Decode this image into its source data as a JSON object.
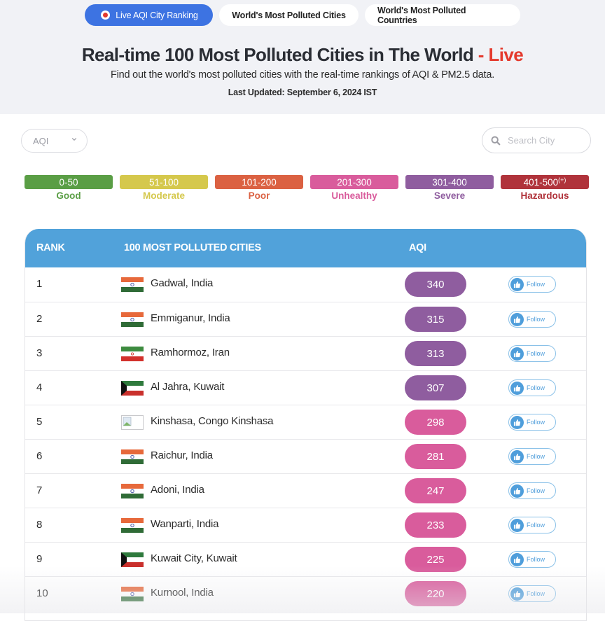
{
  "tabs": [
    {
      "label": "Live AQI City Ranking",
      "active": true,
      "icon": "live-dot-icon"
    },
    {
      "label": "World's Most Polluted Cities",
      "active": false
    },
    {
      "label": "World's Most Polluted Countries",
      "active": false
    }
  ],
  "header": {
    "title": "Real-time 100 Most Polluted Cities in The World",
    "title_live": " - Live",
    "subtitle": "Find out the world's most polluted cities with the real-time rankings of AQI & PM2.5 data.",
    "last_updated": "Last Updated: September 6, 2024 IST"
  },
  "filters": {
    "metric_selected": "AQI",
    "search_placeholder": "Search City"
  },
  "legend": [
    {
      "range": "0-50",
      "sup": "",
      "label": "Good",
      "color": "#5a9e45"
    },
    {
      "range": "51-100",
      "sup": "",
      "label": "Moderate",
      "color": "#d5c84c"
    },
    {
      "range": "101-200",
      "sup": "",
      "label": "Poor",
      "color": "#db6142"
    },
    {
      "range": "201-300",
      "sup": "",
      "label": "Unhealthy",
      "color": "#d95c9c"
    },
    {
      "range": "301-400",
      "sup": "",
      "label": "Severe",
      "color": "#8f5d9f"
    },
    {
      "range": "401-500",
      "sup": "(+)",
      "label": "Hazardous",
      "color": "#b0333b"
    }
  ],
  "table": {
    "headers": {
      "rank": "RANK",
      "city": "100 MOST POLLUTED CITIES",
      "aqi": "AQI"
    },
    "follow_label": "Follow",
    "rows": [
      {
        "rank": "1",
        "city": "Gadwal, India",
        "flag": "india",
        "aqi": "340",
        "color": "#8f5d9f"
      },
      {
        "rank": "2",
        "city": "Emmiganur, India",
        "flag": "india",
        "aqi": "315",
        "color": "#8f5d9f"
      },
      {
        "rank": "3",
        "city": "Ramhormoz, Iran",
        "flag": "iran",
        "aqi": "313",
        "color": "#8f5d9f"
      },
      {
        "rank": "4",
        "city": "Al Jahra, Kuwait",
        "flag": "kuwait",
        "aqi": "307",
        "color": "#8f5d9f"
      },
      {
        "rank": "5",
        "city": "Kinshasa, Congo Kinshasa",
        "flag": "broken",
        "aqi": "298",
        "color": "#d95c9c"
      },
      {
        "rank": "6",
        "city": "Raichur, India",
        "flag": "india",
        "aqi": "281",
        "color": "#d95c9c"
      },
      {
        "rank": "7",
        "city": "Adoni, India",
        "flag": "india",
        "aqi": "247",
        "color": "#d95c9c"
      },
      {
        "rank": "8",
        "city": "Wanparti, India",
        "flag": "india",
        "aqi": "233",
        "color": "#d95c9c"
      },
      {
        "rank": "9",
        "city": "Kuwait City, Kuwait",
        "flag": "kuwait",
        "aqi": "225",
        "color": "#d95c9c"
      },
      {
        "rank": "10",
        "city": "Kurnool, India",
        "flag": "india",
        "aqi": "220",
        "color": "#d95c9c"
      }
    ]
  }
}
